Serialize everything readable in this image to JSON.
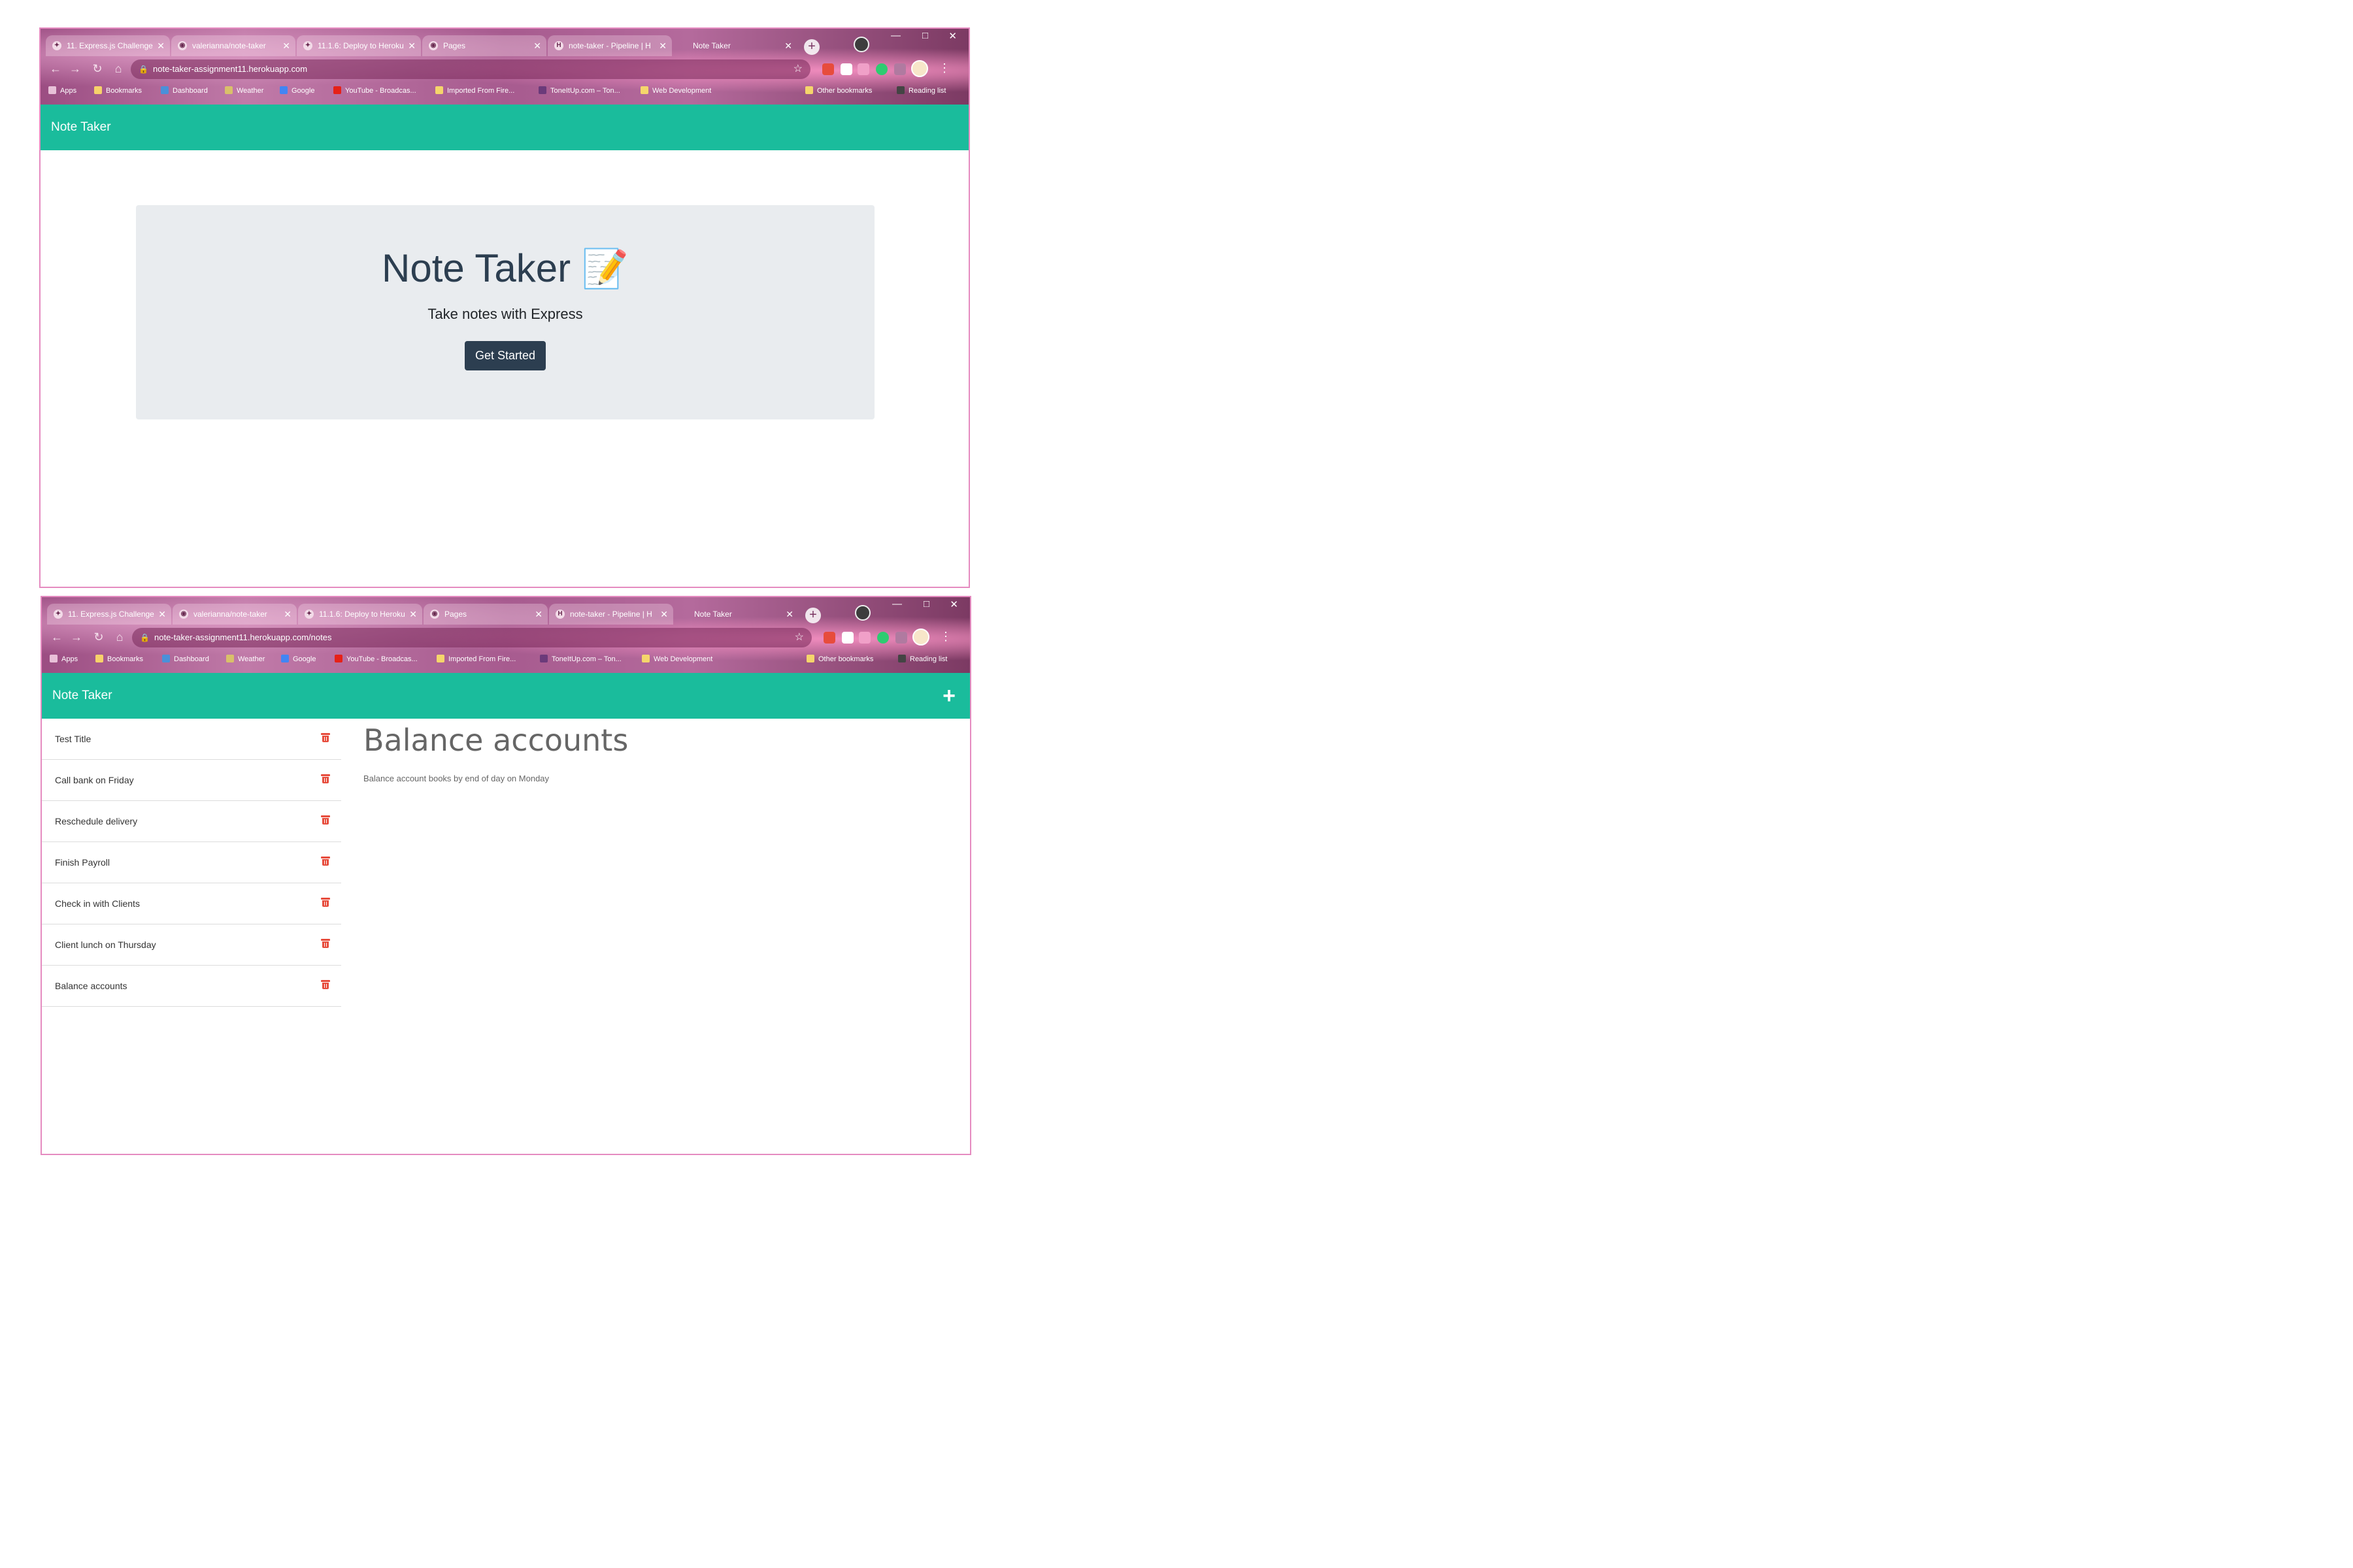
{
  "browser1": {
    "tabs": [
      {
        "label": "11. Express.js Challenge",
        "favicon": "challenge-icon"
      },
      {
        "label": "valerianna/note-taker",
        "favicon": "github-icon"
      },
      {
        "label": "11.1.6: Deploy to Heroku",
        "favicon": "challenge-icon"
      },
      {
        "label": "Pages",
        "favicon": "github-icon"
      },
      {
        "label": "note-taker - Pipeline | H",
        "favicon": "heroku-icon"
      },
      {
        "label": "Note Taker",
        "favicon": "none"
      }
    ],
    "url": "note-taker-assignment11.herokuapp.com"
  },
  "browser2": {
    "tabs": [
      {
        "label": "11. Express.js Challenge",
        "favicon": "challenge-icon"
      },
      {
        "label": "valerianna/note-taker",
        "favicon": "github-icon"
      },
      {
        "label": "11.1.6: Deploy to Heroku",
        "favicon": "challenge-icon"
      },
      {
        "label": "Pages",
        "favicon": "github-icon"
      },
      {
        "label": "note-taker - Pipeline | H",
        "favicon": "heroku-icon"
      },
      {
        "label": "Note Taker",
        "favicon": "none"
      }
    ],
    "url": "note-taker-assignment11.herokuapp.com/notes"
  },
  "bookmarks": {
    "apps": "Apps",
    "items": [
      "Bookmarks",
      "Dashboard",
      "Weather",
      "Google",
      "YouTube - Broadcas...",
      "Imported From Fire...",
      "ToneItUp.com – Ton...",
      "Web Development"
    ],
    "other": "Other bookmarks",
    "reading": "Reading list"
  },
  "app": {
    "brand": "Note Taker",
    "add_icon": "plus-icon"
  },
  "landing": {
    "title": "Note Taker",
    "title_emoji": "📝",
    "subtitle": "Take notes with Express",
    "button": "Get Started"
  },
  "notes": {
    "list": [
      "Test Title",
      "Call bank on Friday",
      "Reschedule delivery",
      "Finish Payroll",
      "Check in with Clients",
      "Client lunch on Thursday",
      "Balance accounts"
    ],
    "active": {
      "title": "Balance accounts",
      "text": "Balance account books by end of day on Monday"
    }
  },
  "colors": {
    "header": "#1abc9c",
    "jumbotron": "#e9ecef",
    "button": "#2c3e50",
    "trash": "#e74c3c",
    "frame_border": "#e58bc0"
  }
}
